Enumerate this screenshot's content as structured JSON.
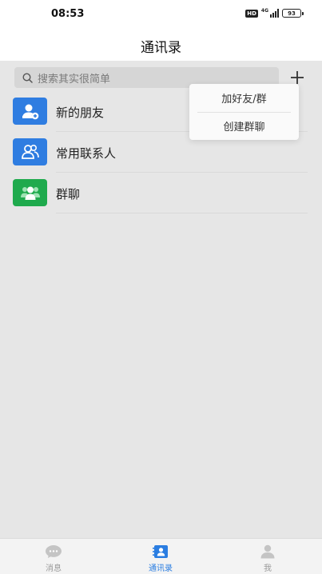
{
  "status_bar": {
    "time": "08:53",
    "hd": "HD",
    "network": "4G",
    "battery": "93"
  },
  "nav": {
    "title": "通讯录"
  },
  "search": {
    "placeholder": "搜索其实很简单"
  },
  "contacts": {
    "items": [
      {
        "label": "新的朋友",
        "icon": "add-friend-icon",
        "color": "#2f7de1"
      },
      {
        "label": "常用联系人",
        "icon": "contacts-icon",
        "color": "#2f7de1"
      },
      {
        "label": "群聊",
        "icon": "group-chat-icon",
        "color": "#1faa4d"
      }
    ]
  },
  "popup_menu": {
    "items": [
      {
        "label": "加好友/群"
      },
      {
        "label": "创建群聊"
      }
    ]
  },
  "tab_bar": {
    "items": [
      {
        "label": "消息",
        "icon": "chat-bubble-icon"
      },
      {
        "label": "通讯录",
        "icon": "contacts-book-icon",
        "active": true
      },
      {
        "label": "我",
        "icon": "profile-icon"
      }
    ]
  },
  "colors": {
    "accent": "#2a7de1",
    "green": "#1faa4d"
  }
}
